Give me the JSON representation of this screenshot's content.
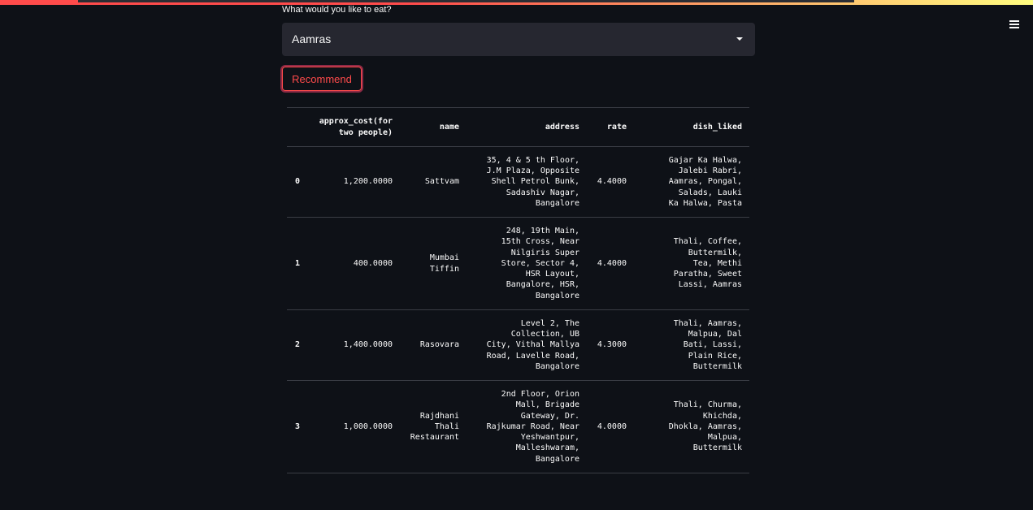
{
  "header": {
    "menu_icon": "hamburger-menu-icon"
  },
  "form": {
    "select_label": "What would you like to eat?",
    "select_value": "Aamras",
    "caret_icon": "caret-down-icon",
    "button_label": "Recommend"
  },
  "colors": {
    "background": "#0e1117",
    "accent": "#ff4b4b",
    "select_bg": "#262730"
  },
  "table": {
    "columns": [
      "",
      "approx_cost(for two people)",
      "name",
      "address",
      "rate",
      "dish_liked"
    ],
    "rows": [
      {
        "index": "0",
        "cost": "1,200.0000",
        "name": "Sattvam",
        "address": [
          "35, 4 & 5 th Floor,",
          "J.M Plaza, Opposite",
          "Shell Petrol Bunk,",
          "Sadashiv Nagar,",
          "Bangalore"
        ],
        "rate": "4.4000",
        "dishes": [
          "Gajar Ka Halwa,",
          "Jalebi Rabri,",
          "Aamras, Pongal,",
          "Salads, Lauki",
          "Ka Halwa, Pasta"
        ]
      },
      {
        "index": "1",
        "cost": "400.0000",
        "name": "Mumbai Tiffin",
        "address": [
          "248, 19th Main,",
          "15th Cross, Near",
          "Nilgiris Super",
          "Store, Sector 4,",
          "HSR Layout,",
          "Bangalore, HSR,",
          "Bangalore"
        ],
        "rate": "4.4000",
        "dishes": [
          "Thali, Coffee,",
          "Buttermilk,",
          "Tea, Methi",
          "Paratha, Sweet",
          "Lassi, Aamras"
        ]
      },
      {
        "index": "2",
        "cost": "1,400.0000",
        "name": "Rasovara",
        "address": [
          "Level 2, The",
          "Collection, UB",
          "City, Vithal Mallya",
          "Road, Lavelle Road,",
          "Bangalore"
        ],
        "rate": "4.3000",
        "dishes": [
          "Thali, Aamras,",
          "Malpua, Dal",
          "Bati, Lassi,",
          "Plain Rice,",
          "Buttermilk"
        ]
      },
      {
        "index": "3",
        "cost": "1,000.0000",
        "name": "Rajdhani Thali Restaurant",
        "address": [
          "2nd Floor, Orion",
          "Mall, Brigade",
          "Gateway, Dr.",
          "Rajkumar Road, Near",
          "Yeshwantpur,",
          "Malleshwaram,",
          "Bangalore"
        ],
        "rate": "4.0000",
        "dishes": [
          "Thali, Churma,",
          "Khichda,",
          "Dhokla, Aamras,",
          "Malpua,",
          "Buttermilk"
        ]
      }
    ]
  }
}
